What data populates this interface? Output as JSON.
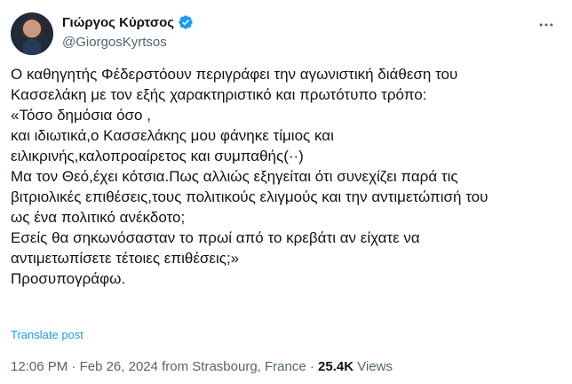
{
  "author": {
    "display_name": "Γιώργος Κύρτσος",
    "handle": "@GiorgosKyrtsos"
  },
  "tweet": {
    "lines": [
      "Ο καθηγητής Φέδερστόουν περιγράφει την αγωνιστική διάθεση του",
      "Κασσελάκη με τον εξής χαρακτηριστικό και πρωτότυπο τρόπο:",
      "«Τόσο δημόσια όσο ,",
      "και ιδιωτικά,ο Κασσελάκης μου φάνηκε τίμιος και",
      "ειλικρινής,καλοπροαίρετος και συμπαθής(··)",
      "Μα τον Θεό,έχει κότσια.Πως αλλιώς εξηγείται ότι συνεχίζει παρά τις",
      "βιτριολικές επιθέσεις,τους πολιτικούς ελιγμούς και την αντιμετώπισή του",
      "ως ένα πολιτικό ανέκδοτο;",
      "Εσείς θα σηκωνόσασταν το πρωί από το κρεβάτι αν είχατε να",
      "αντιμετωπίσετε τέτοιες επιθέσεις;»",
      "Προσυπογράφω."
    ],
    "translate_label": "Translate post"
  },
  "meta": {
    "time": "12:06 PM",
    "separator": " · ",
    "date": "Feb 26, 2024 from Strasbourg, France",
    "views_count": "25.4K",
    "views_label": " Views"
  },
  "icons": {
    "verified": "verified-badge-icon",
    "more": "more-icon"
  },
  "colors": {
    "accent": "#1d9bf0",
    "text": "#0f1419",
    "secondary": "#536471"
  }
}
